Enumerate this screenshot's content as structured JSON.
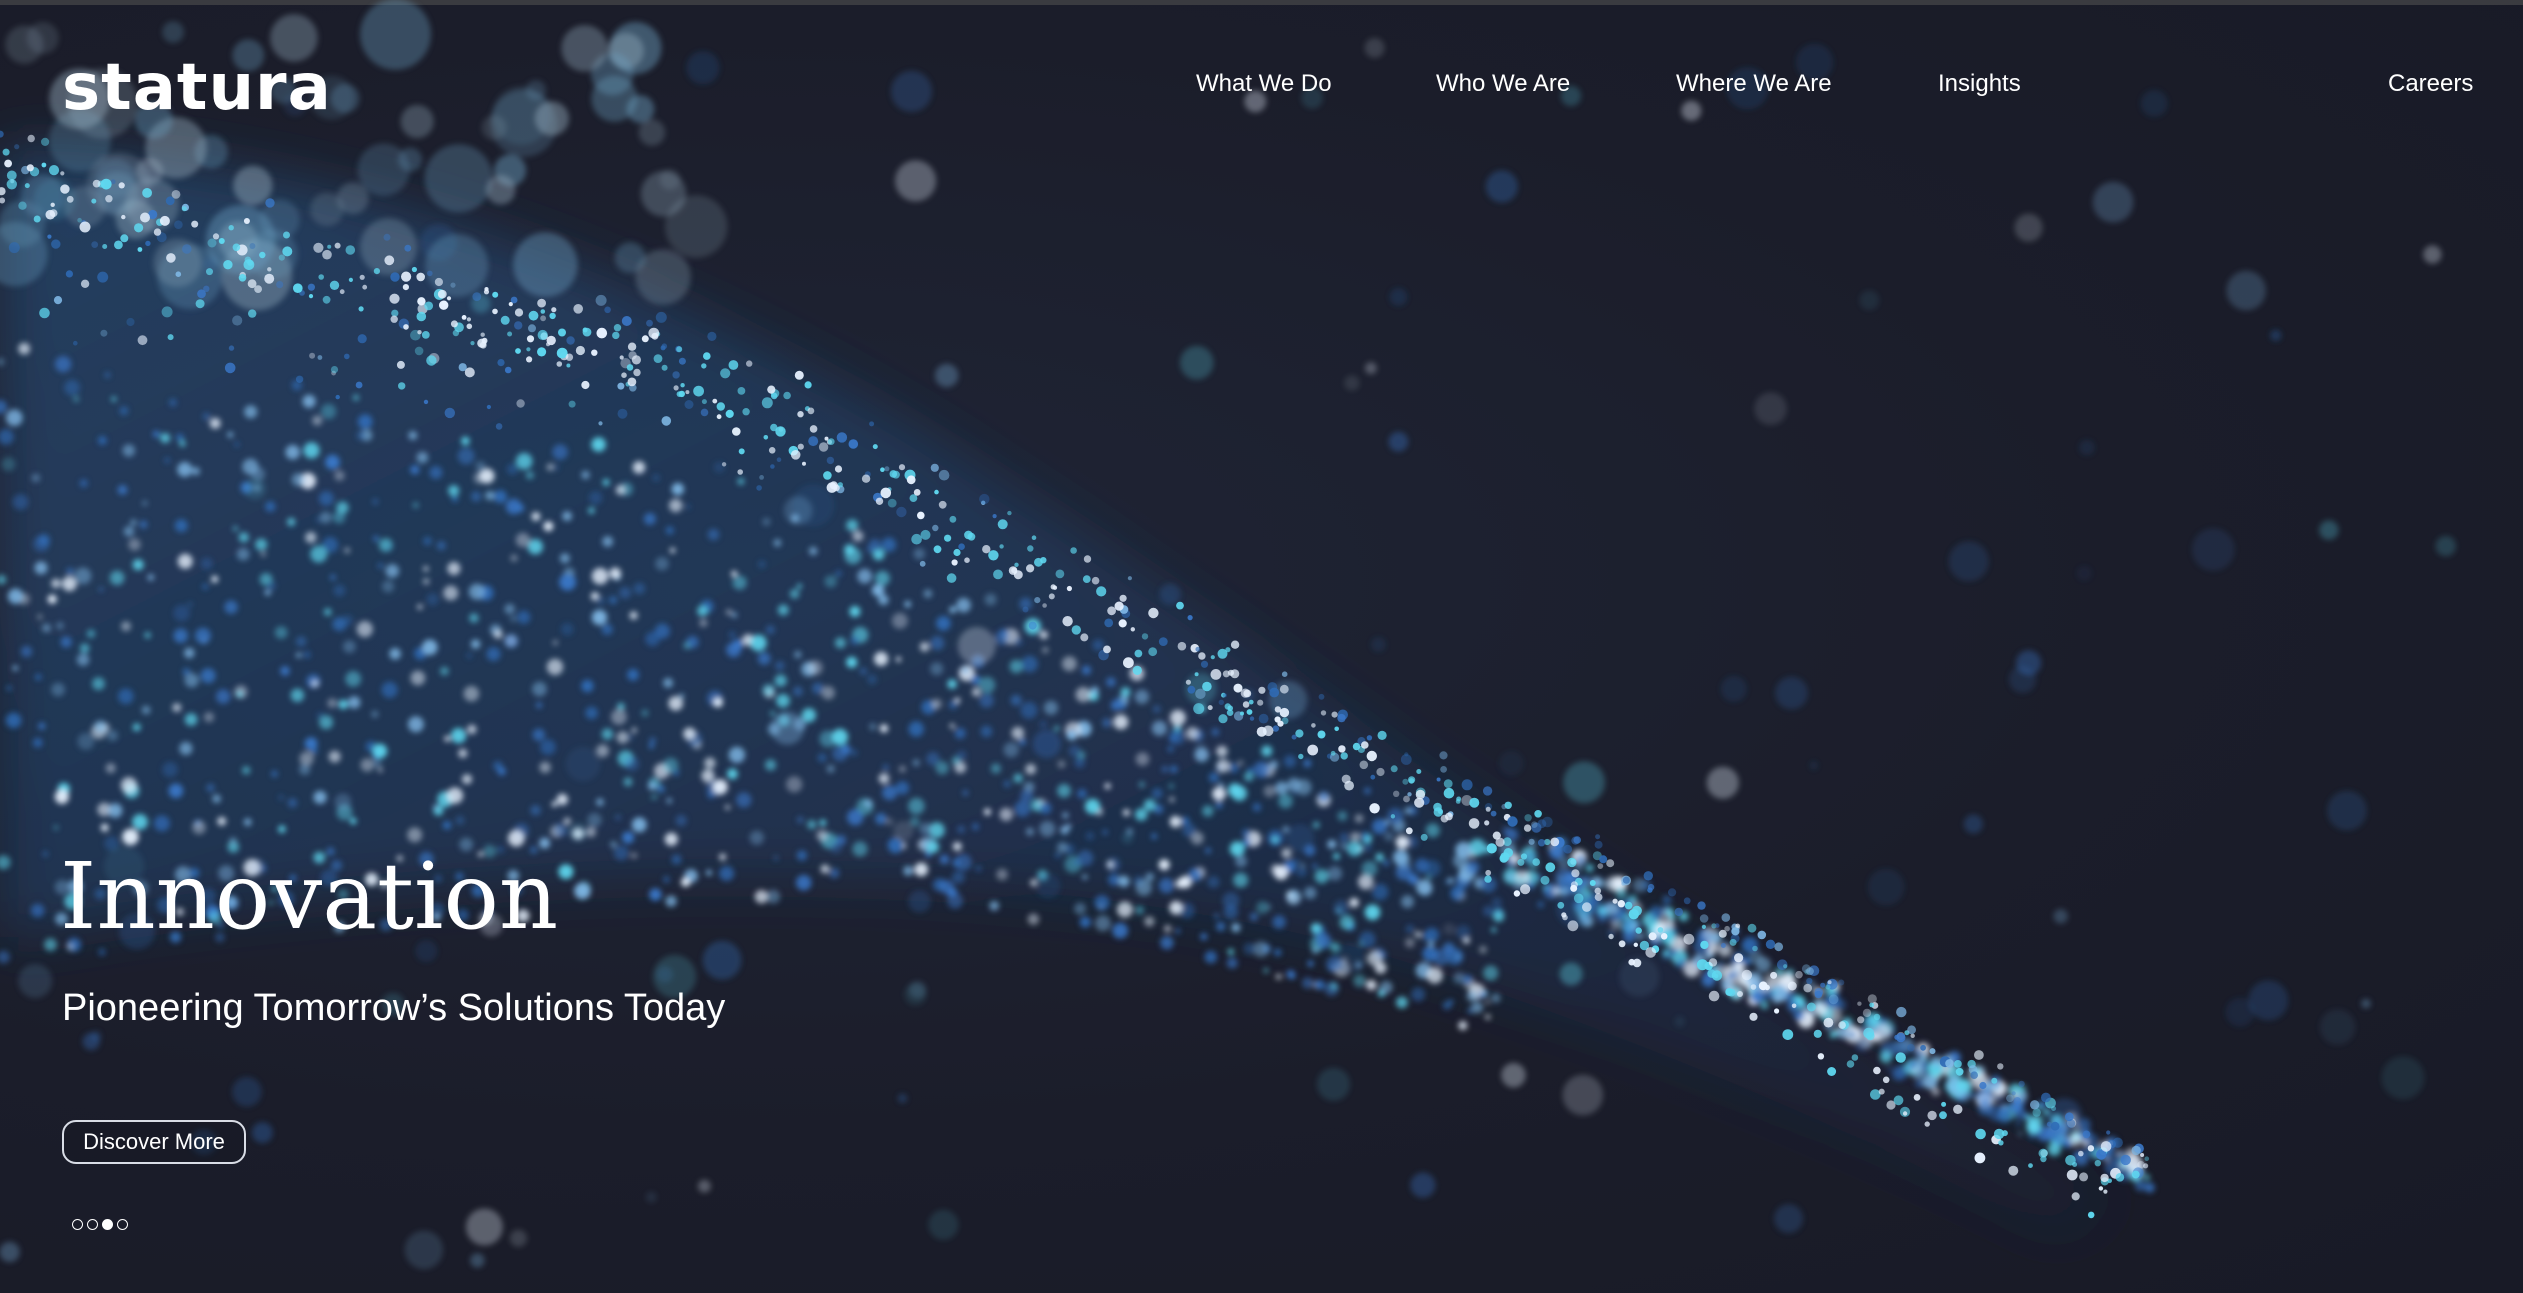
{
  "brand": {
    "logo_text": "statura"
  },
  "nav": {
    "items": [
      {
        "label": "What We Do"
      },
      {
        "label": "Who We Are"
      },
      {
        "label": "Where We Are"
      },
      {
        "label": "Insights"
      }
    ],
    "careers_label": "Careers"
  },
  "hero": {
    "title": "Innovation",
    "subtitle": "Pioneering Tomorrow’s Solutions Today",
    "cta_label": "Discover More",
    "background_image": "particle-wave-image"
  },
  "carousel": {
    "total_slides": 4,
    "active_slide": 3
  },
  "colors": {
    "background": "#1b1d2a",
    "text": "#ffffff",
    "particle_cyan": "#5fd8f0",
    "particle_blue": "#3a78c9",
    "particle_white": "#e8f2ff"
  }
}
